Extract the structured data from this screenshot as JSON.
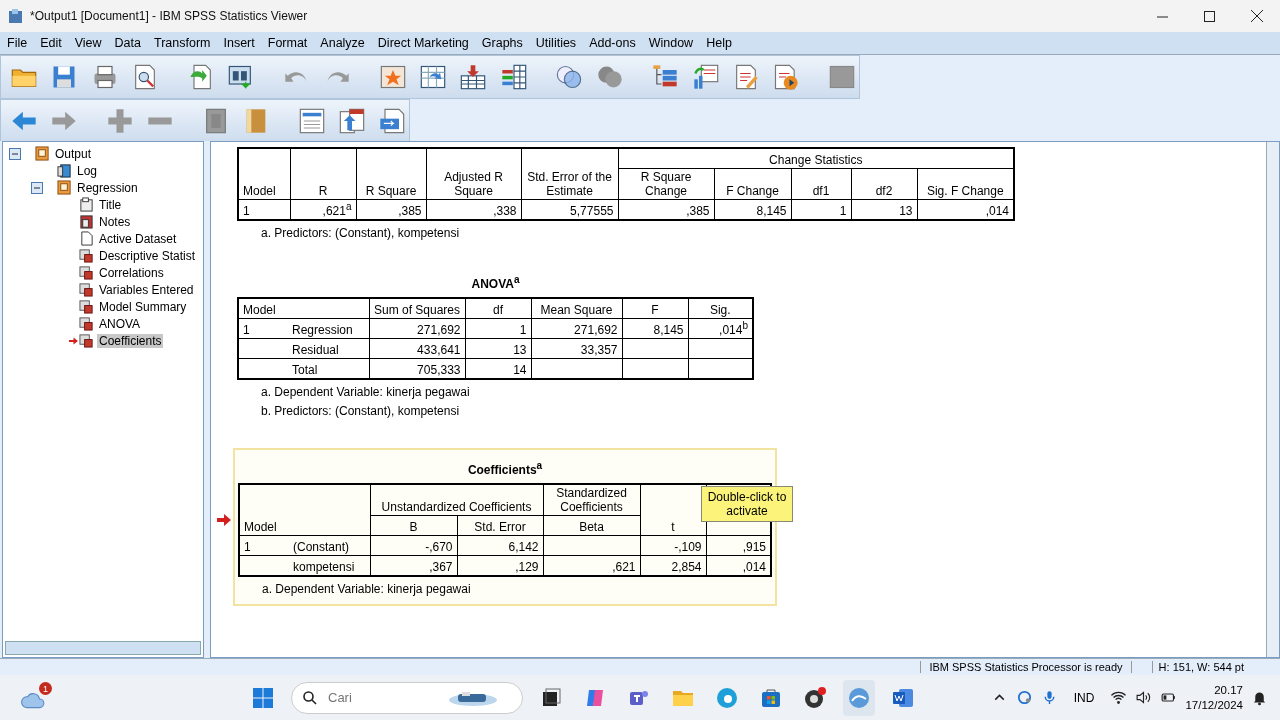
{
  "window": {
    "title": "*Output1 [Document1] - IBM SPSS Statistics Viewer"
  },
  "menu": [
    "File",
    "Edit",
    "View",
    "Data",
    "Transform",
    "Insert",
    "Format",
    "Analyze",
    "Direct Marketing",
    "Graphs",
    "Utilities",
    "Add-ons",
    "Window",
    "Help"
  ],
  "outline": {
    "label": "Output",
    "kind": "book",
    "expanded": true,
    "selected": false,
    "children": [
      {
        "label": "Log",
        "kind": "log",
        "selected": false
      },
      {
        "label": "Regression",
        "kind": "book",
        "expanded": true,
        "selected": false,
        "children": [
          {
            "label": "Title",
            "kind": "title",
            "selected": false
          },
          {
            "label": "Notes",
            "kind": "notes",
            "selected": false
          },
          {
            "label": "Active Dataset",
            "kind": "text",
            "selected": false
          },
          {
            "label": "Descriptive Statist",
            "kind": "table",
            "selected": false
          },
          {
            "label": "Correlations",
            "kind": "table",
            "selected": false
          },
          {
            "label": "Variables Entered",
            "kind": "table",
            "selected": false
          },
          {
            "label": "Model Summary",
            "kind": "table",
            "selected": false
          },
          {
            "label": "ANOVA",
            "kind": "table",
            "selected": false
          },
          {
            "label": "Coefficients",
            "kind": "table",
            "selected": true
          }
        ]
      }
    ]
  },
  "model_summary": {
    "columns": [
      "Model",
      "R",
      "R Square",
      "Adjusted R Square",
      "Std. Error of the Estimate"
    ],
    "group": {
      "title": "Change Statistics",
      "columns": [
        "R Square Change",
        "F Change",
        "df1",
        "df2",
        "Sig. F Change"
      ]
    },
    "rows": [
      [
        "1",
        ",621$^{a}$",
        ",385",
        ",338",
        "5,77555",
        ",385",
        "8,145",
        "1",
        "13",
        ",014"
      ]
    ],
    "footnotes": [
      "a. Predictors: (Constant), kompetensi"
    ]
  },
  "anova": {
    "title": "ANOVA$^{a}$",
    "columns": [
      "Model",
      "Sum of Squares",
      "df",
      "Mean Square",
      "F",
      "Sig."
    ],
    "rows": [
      {
        "model": "1",
        "source": "Regression",
        "sum_of_squares": "271,692",
        "df": "1",
        "mean_square": "271,692",
        "f": "8,145",
        "sig": ",014$^{b}$"
      },
      {
        "source": "Residual",
        "sum_of_squares": "433,641",
        "df": "13",
        "mean_square": "33,357"
      },
      {
        "source": "Total",
        "sum_of_squares": "705,333",
        "df": "14"
      }
    ],
    "footnotes": [
      "a. Dependent Variable: kinerja pegawai",
      "b. Predictors: (Constant), kompetensi"
    ]
  },
  "coefficients": {
    "selected": true,
    "title": "Coefficients$^{a}$",
    "model_header": "Model",
    "unstandardized": {
      "title": "Unstandardized Coefficients",
      "columns": [
        "B",
        "Std. Error"
      ]
    },
    "standardized": {
      "title": "Standardized Coefficients",
      "columns": [
        "Beta"
      ]
    },
    "t_header": "t",
    "rows": [
      {
        "model": "1",
        "term": "(Constant)",
        "b": "-,670",
        "std_error": "6,142",
        "t": "-,109",
        "sig": ",915"
      },
      {
        "term": "kompetensi",
        "b": ",367",
        "std_error": ",129",
        "beta": ",621",
        "t": "2,854",
        "sig": ",014"
      }
    ],
    "footnotes": [
      "a. Dependent Variable: kinerja pegawai"
    ],
    "tooltip": "Double-click to activate"
  },
  "status_bar": {
    "message": "IBM SPSS Statistics Processor is ready",
    "size": "H: 151, W: 544 pt"
  },
  "taskbar": {
    "weather_badge": "1",
    "search": {
      "placeholder": "Cari"
    },
    "language": "IND",
    "time": "20.17",
    "date": "17/12/2024"
  }
}
